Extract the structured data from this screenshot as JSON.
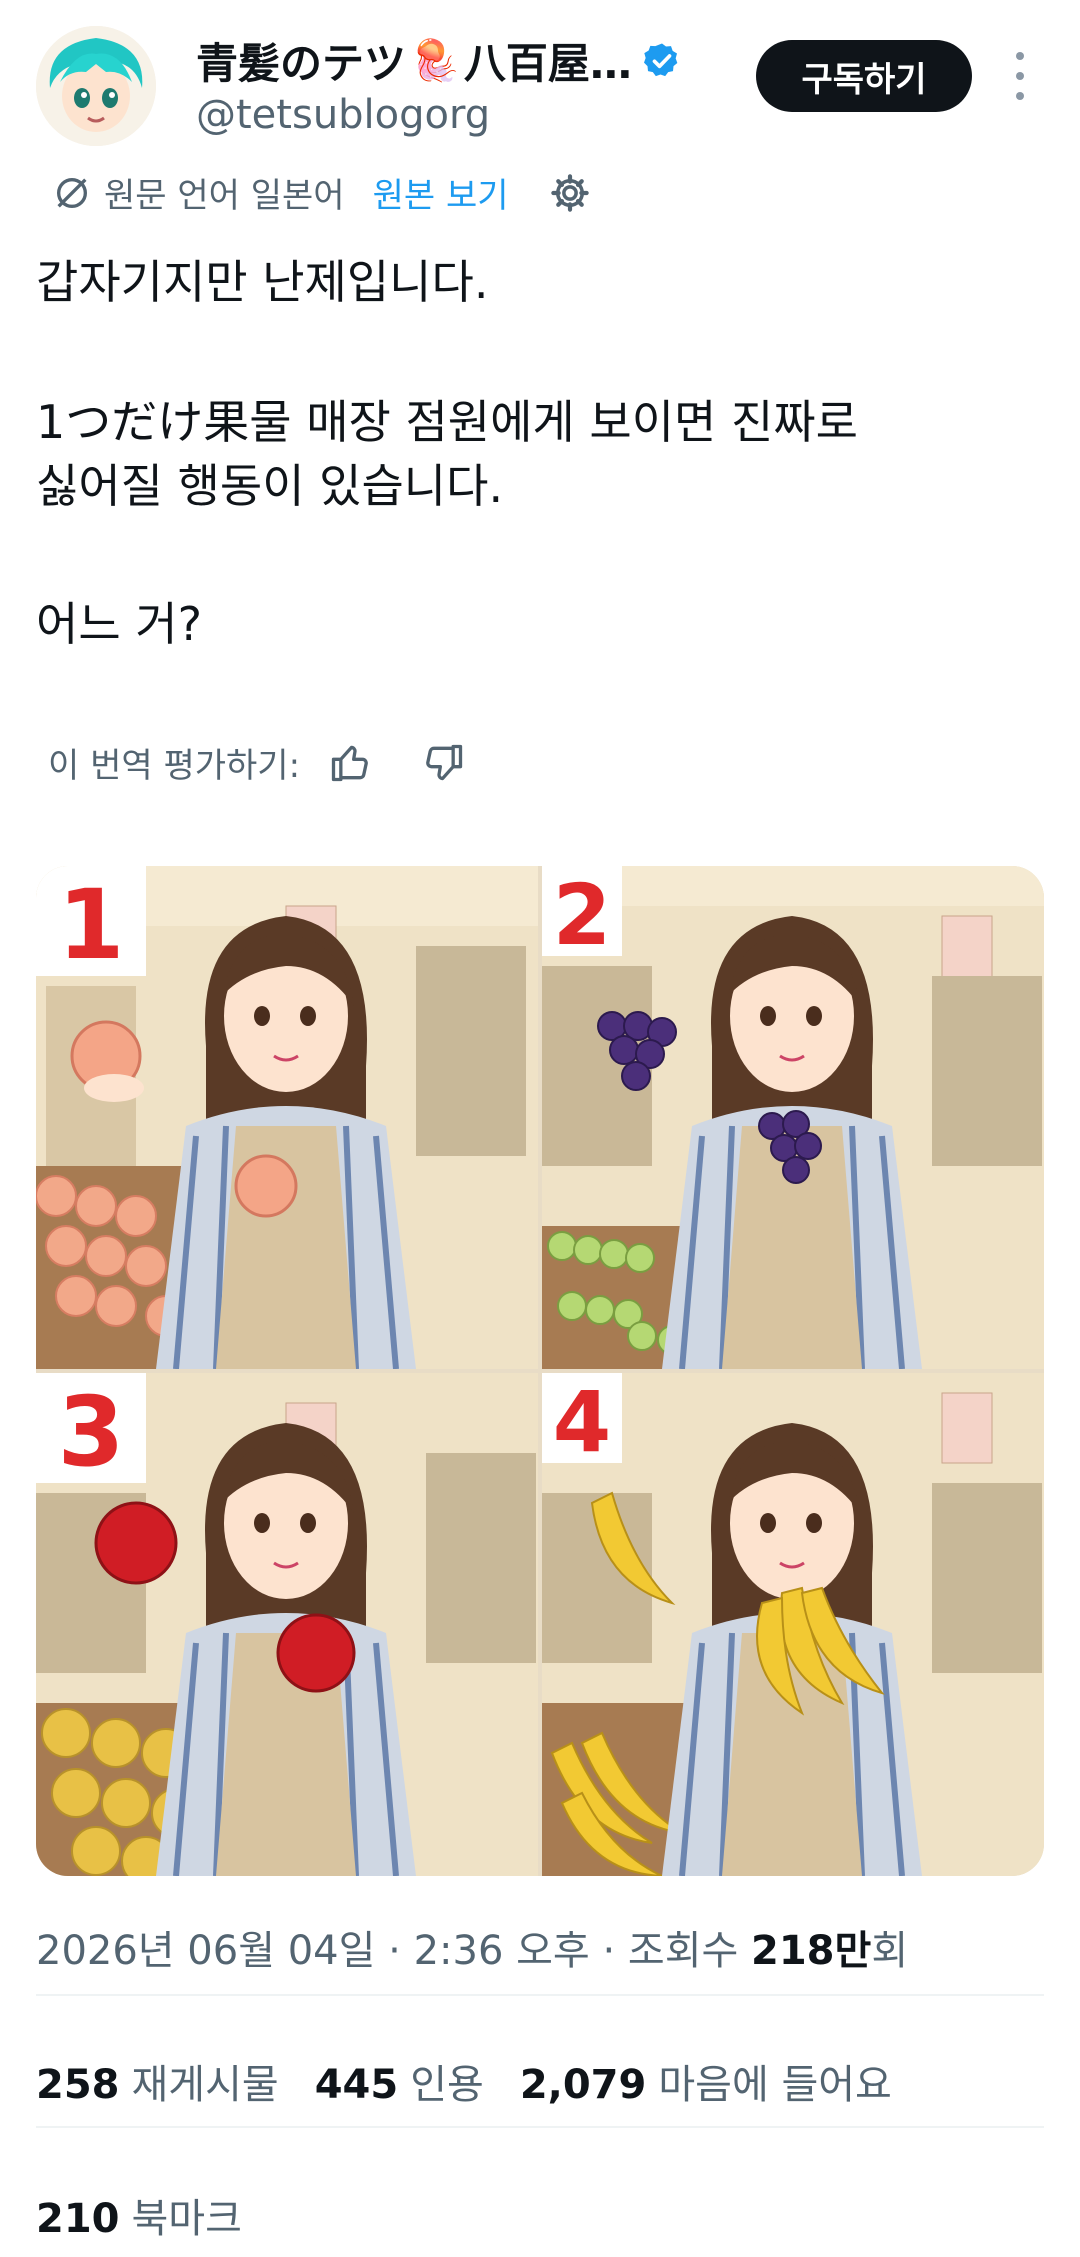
{
  "header": {
    "display_name": "青髪のテツ",
    "display_name_suffix": "八百屋…",
    "name_emoji": "🪼",
    "handle": "@tetsublogorg",
    "subscribe_label": "구독하기"
  },
  "translation": {
    "note": "원문 언어 일본어",
    "view_original": "원본 보기"
  },
  "tweet": {
    "line1": "갑자기지만 난제입니다.",
    "line2": "1つだけ果물 매장 점원에게 보이면 진짜로",
    "line3": "싫어질 행동이 있습니다.",
    "line4": "어느 거?"
  },
  "rating": {
    "label": "이 번역 평가하기:"
  },
  "media": {
    "panels": [
      {
        "number": "1",
        "fruit": "peach"
      },
      {
        "number": "2",
        "fruit": "grapes"
      },
      {
        "number": "3",
        "fruit": "apple"
      },
      {
        "number": "4",
        "fruit": "banana"
      }
    ]
  },
  "meta": {
    "date": "2026년 06월 04일",
    "time": "2:36 오후",
    "views_prefix": "조회수",
    "views_count": "218만",
    "views_suffix": "회",
    "separator": " · "
  },
  "stats": {
    "reposts_count": "258",
    "reposts_label": "재게시물",
    "quotes_count": "445",
    "quotes_label": "인용",
    "likes_count": "2,079",
    "likes_label": "마음에 들어요",
    "bookmarks_count": "210",
    "bookmarks_label": "북마크"
  },
  "colors": {
    "accent": "#1d9bf0",
    "text": "#0f1419",
    "secondary": "#536471"
  }
}
